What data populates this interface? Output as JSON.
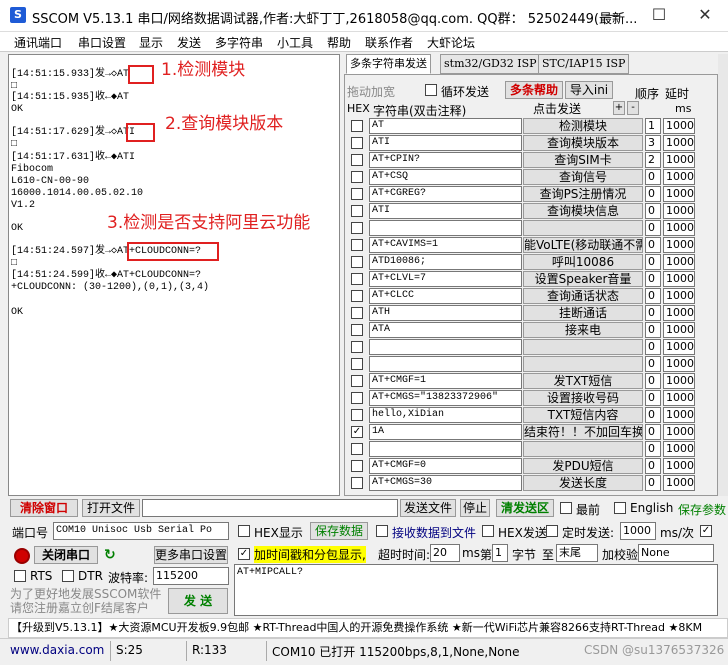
{
  "window": {
    "title": "SSCOM V5.13.1 串口/网络数据调试器,作者:大虾丁丁,2618058@qq.com. QQ群： 52502449(最新...",
    "app_icon": "S",
    "minimize": "—",
    "maximize": "☐",
    "close": "✕"
  },
  "menu": [
    "通讯端口",
    "串口设置",
    "显示",
    "发送",
    "多字符串",
    "小工具",
    "帮助",
    "联系作者",
    "大虾论坛"
  ],
  "terminal": {
    "lines": [
      "[14:51:15.933]发→◇AT",
      "□",
      "[14:51:15.935]收←◆AT",
      "OK",
      "[14:51:17.629]发→◇ATI",
      "□",
      "[14:51:17.631]收←◆ATI",
      "Fibocom",
      "L610-CN-00-90",
      "16000.1014.00.05.02.10",
      "V1.2",
      "OK",
      "[14:51:24.597]发→◇AT+CLOUDCONN=?",
      "□",
      "[14:51:24.599]收←◆AT+CLOUDCONN=?",
      "+CLOUDCONN: (30-1200),(0,1),(3,4)",
      "OK"
    ],
    "annotations": [
      "1.检测模块",
      "2.查询模块版本",
      "3.检测是否支持阿里云功能"
    ]
  },
  "tabs": [
    "多条字符串发送",
    "stm32/GD32 ISP",
    "STC/IAP15 ISP"
  ],
  "multi": {
    "drag_label": "拖动加宽",
    "loop_label": "循环发送",
    "help_label": "多条帮助",
    "import_label": "导入ini",
    "order_label": "顺序",
    "delay_label": "延时",
    "hex_label": "HEX",
    "str_label": "字符串(双击注释)",
    "click_send": "点击发送",
    "plus": "+",
    "minus": "-",
    "ms": "ms",
    "rows": [
      {
        "checked": false,
        "cmd": "AT",
        "btn": "检测模块",
        "ord": "1",
        "delay": "1000"
      },
      {
        "checked": false,
        "cmd": "ATI",
        "btn": "查询模块版本",
        "ord": "3",
        "delay": "1000"
      },
      {
        "checked": false,
        "cmd": "AT+CPIN?",
        "btn": "查询SIM卡",
        "ord": "2",
        "delay": "1000"
      },
      {
        "checked": false,
        "cmd": "AT+CSQ",
        "btn": "查询信号",
        "ord": "0",
        "delay": "1000"
      },
      {
        "checked": false,
        "cmd": "AT+CGREG?",
        "btn": "查询PS注册情况",
        "ord": "0",
        "delay": "1000"
      },
      {
        "checked": false,
        "cmd": "ATI",
        "btn": "查询模块信息",
        "ord": "0",
        "delay": "1000"
      },
      {
        "checked": false,
        "cmd": "",
        "btn": "",
        "ord": "0",
        "delay": "1000"
      },
      {
        "checked": false,
        "cmd": "AT+CAVIMS=1",
        "btn": "能VoLTE(移动联通不需",
        "ord": "0",
        "delay": "1000"
      },
      {
        "checked": false,
        "cmd": "ATD10086;",
        "btn": "呼叫10086",
        "ord": "0",
        "delay": "1000"
      },
      {
        "checked": false,
        "cmd": "AT+CLVL=7",
        "btn": "设置Speaker音量",
        "ord": "0",
        "delay": "1000"
      },
      {
        "checked": false,
        "cmd": "AT+CLCC",
        "btn": "查询通话状态",
        "ord": "0",
        "delay": "1000"
      },
      {
        "checked": false,
        "cmd": "ATH",
        "btn": "挂断通话",
        "ord": "0",
        "delay": "1000"
      },
      {
        "checked": false,
        "cmd": "ATA",
        "btn": "接来电",
        "ord": "0",
        "delay": "1000"
      },
      {
        "checked": false,
        "cmd": "",
        "btn": "",
        "ord": "0",
        "delay": "1000"
      },
      {
        "checked": false,
        "cmd": "",
        "btn": "",
        "ord": "0",
        "delay": "1000"
      },
      {
        "checked": false,
        "cmd": "AT+CMGF=1",
        "btn": "发TXT短信",
        "ord": "0",
        "delay": "1000"
      },
      {
        "checked": false,
        "cmd": "AT+CMGS=\"13823372906\"",
        "btn": "设置接收号码",
        "ord": "0",
        "delay": "1000"
      },
      {
        "checked": false,
        "cmd": "hello,XiDian",
        "btn": "TXT短信内容",
        "ord": "0",
        "delay": "1000"
      },
      {
        "checked": true,
        "cmd": "1A",
        "btn": "结束符！！不加回车换行",
        "ord": "0",
        "delay": "1000"
      },
      {
        "checked": false,
        "cmd": "",
        "btn": "",
        "ord": "0",
        "delay": "1000"
      },
      {
        "checked": false,
        "cmd": "AT+CMGF=0",
        "btn": "发PDU短信",
        "ord": "0",
        "delay": "1000"
      },
      {
        "checked": false,
        "cmd": "AT+CMGS=30",
        "btn": "发送长度",
        "ord": "0",
        "delay": "1000"
      }
    ]
  },
  "toolbar": {
    "clear_window": "清除窗口",
    "open_file": "打开文件",
    "send_file": "发送文件",
    "stop": "停止",
    "clear_send": "清发送区",
    "latest": "最前",
    "english": "English",
    "save_params": "保存参数"
  },
  "port": {
    "port_label": "端口号",
    "port_value": "COM10 Unisoc Usb Serial Po",
    "hex_display": "HEX显示",
    "save_data": "保存数据",
    "recv_to_file": "接收数据到文件",
    "hex_send": "HEX发送",
    "timed_send": "定时发送:",
    "timed_value": "1000",
    "ms_per": "ms/次",
    "close_port": "关闭串口",
    "more_settings": "更多串口设置",
    "timestamp": "加时间戳和分包显示,",
    "timeout_label": "超时时间:",
    "timeout_value": "20",
    "ms": "ms",
    "nth": "第",
    "nth_value": "1",
    "byte": "字节",
    "to": "至",
    "end_value": "末尾",
    "checksum": "加校验",
    "checksum_value": "None",
    "rts": "RTS",
    "dtr": "DTR",
    "baud_label": "波特率:",
    "baud_value": "115200",
    "send_text": "AT+MIPCALL?",
    "promo": "为了更好地发展SSCOM软件\n请您注册嘉立创F结尾客户",
    "send_button": "发 送"
  },
  "ticker": "【升级到V5.13.1】★大资源MCU开发板9.9包邮 ★RT-Thread中国人的开源免费操作系统 ★新一代WiFi芯片兼容8266支持RT-Thread ★8KM",
  "status": {
    "site": "www.daxia.com",
    "s": "S:25",
    "r": "R:133",
    "port_state": "COM10 已打开  115200bps,8,1,None,None",
    "csdn": "CSDN @su1376537326"
  }
}
